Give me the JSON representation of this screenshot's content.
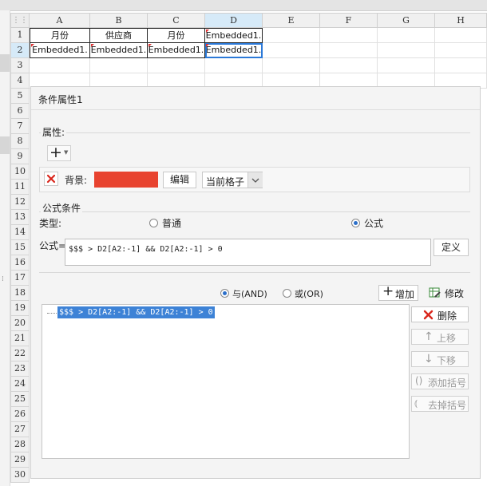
{
  "sheet": {
    "columns": [
      "A",
      "B",
      "C",
      "D",
      "E",
      "F",
      "G",
      "H"
    ],
    "rows": [
      "1",
      "2",
      "3",
      "4",
      "5",
      "6",
      "7",
      "8",
      "9",
      "10",
      "11",
      "12",
      "13",
      "14",
      "15",
      "16",
      "17",
      "18",
      "19",
      "20",
      "21",
      "22",
      "23",
      "24",
      "25",
      "26",
      "27",
      "28",
      "29",
      "30"
    ],
    "cells": {
      "A1": "月份",
      "B1": "供应商",
      "C1": "月份",
      "D1": "Embedded1.",
      "A2": "Embedded1.",
      "B2": "Embedded1.",
      "C2": "Embedded1.",
      "D2": "Embedded1."
    }
  },
  "dialog": {
    "title": "条件属性1",
    "attributes": {
      "legend": "属性:",
      "add_glyph": "+",
      "background_label": "背景:",
      "background_color": "#e8432f",
      "edit_button": "编辑",
      "scope_value": "当前格子"
    },
    "formula": {
      "legend": "公式条件",
      "type_label": "类型:",
      "type_normal": "普通",
      "type_formula": "公式",
      "formula_label": "公式=",
      "formula_value": "$$$ > D2[A2:-1] && D2[A2:-1] > 0",
      "define_button": "定义",
      "and_label": "与(AND)",
      "or_label": "或(OR)",
      "add_button": "增加",
      "modify_button": "修改",
      "conditions": [
        "$$$ > D2[A2:-1] && D2[A2:-1] > 0"
      ],
      "delete_button": "删除",
      "up_button": "上移",
      "down_button": "下移",
      "add_bracket_button": "添加括号",
      "remove_bracket_button": "去掉括号"
    }
  },
  "colors": {
    "selection": "#3d82d6",
    "accent": "#2b79d8",
    "delete": "#d9261c"
  }
}
